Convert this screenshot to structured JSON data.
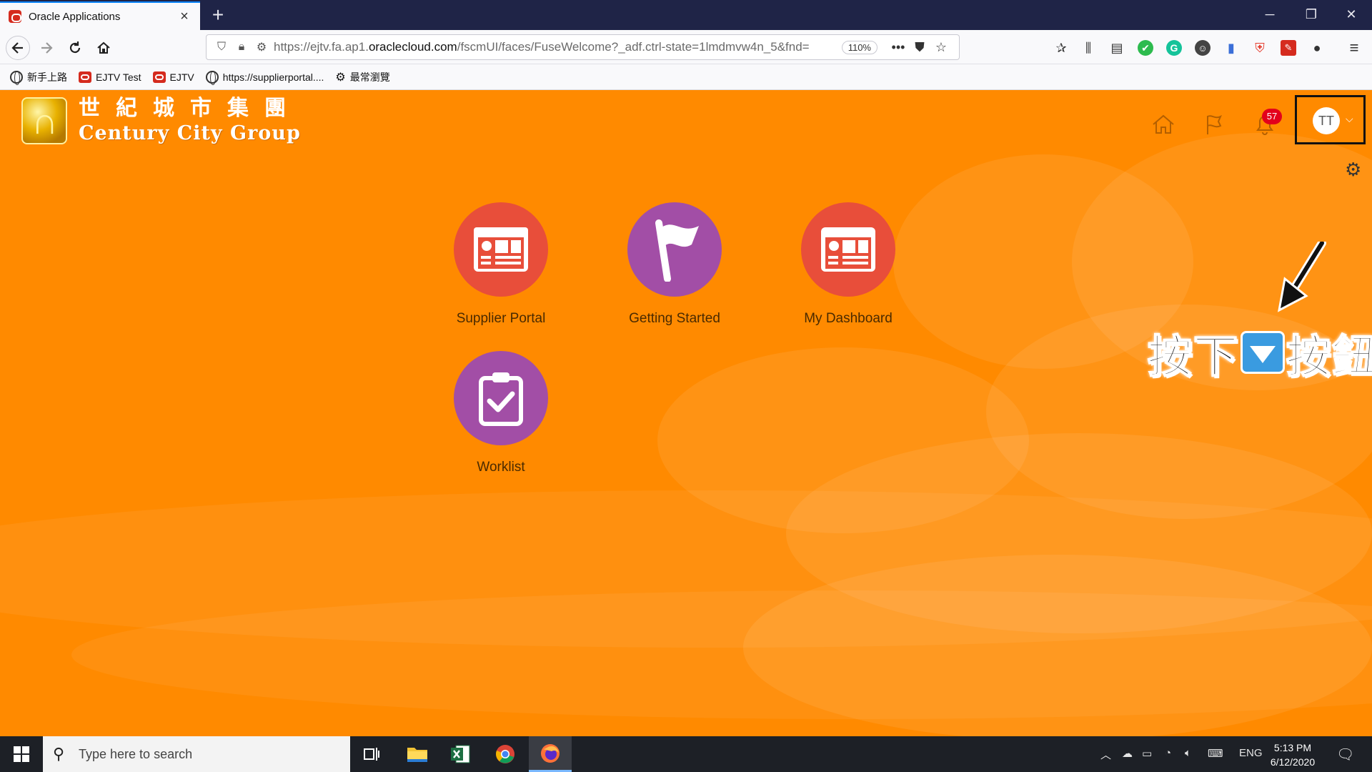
{
  "browser": {
    "tab_title": "Oracle Applications",
    "tab_close": "×",
    "new_tab": "+",
    "url_prefix": "https://ejtv.fa.ap1.",
    "url_domain": "oraclecloud.com",
    "url_suffix": "/fscmUI/faces/FuseWelcome?_adf.ctrl-state=1lmdmvw4n_5&fnd=",
    "zoom": "110%",
    "more_actions": "•••"
  },
  "bookmarks": [
    {
      "label": "新手上路",
      "icon": "globe-icon"
    },
    {
      "label": "EJTV Test",
      "icon": "oracle-icon"
    },
    {
      "label": "EJTV",
      "icon": "oracle-icon"
    },
    {
      "label": "https://supplierportal....",
      "icon": "globe-icon"
    },
    {
      "label": "最常瀏覽",
      "icon": "gear-icon"
    }
  ],
  "header": {
    "logo_cn": "世紀城市集團",
    "logo_en": "Century City Group",
    "notification_count": "57",
    "avatar_initials": "TT"
  },
  "callout": {
    "text_before": "按下",
    "text_after": "按鈕"
  },
  "apps": [
    {
      "label": "Supplier Portal",
      "color": "#e84e3a",
      "icon": "dashboard-icon"
    },
    {
      "label": "Getting Started",
      "color": "#a24ea6",
      "icon": "flag-icon"
    },
    {
      "label": "My Dashboard",
      "color": "#e84e3a",
      "icon": "dashboard-icon"
    },
    {
      "label": "Worklist",
      "color": "#a24ea6",
      "icon": "clipboard-check-icon"
    }
  ],
  "taskbar": {
    "search_placeholder": "Type here to search",
    "language": "ENG",
    "time": "5:13 PM",
    "date": "6/12/2020"
  },
  "colors": {
    "brand_orange": "#ff8a00",
    "tab_bar": "#1f2447",
    "taskbar": "#1d2026",
    "badge_red": "#e3001b"
  }
}
